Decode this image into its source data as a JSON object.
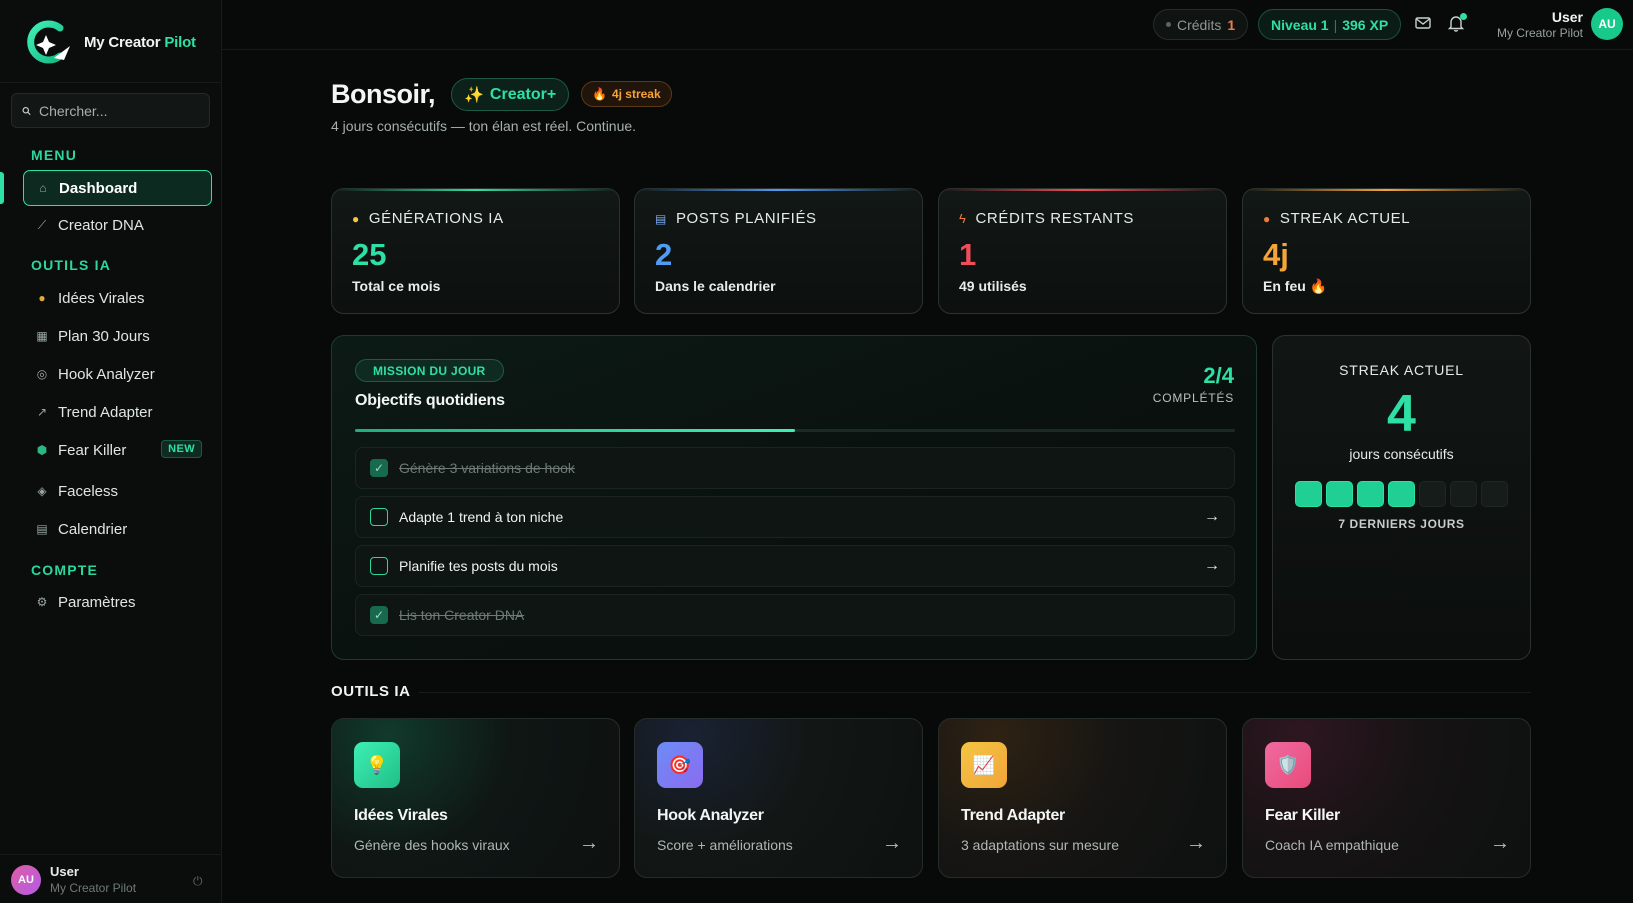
{
  "app": {
    "logo_text_main": "My Creator ",
    "logo_text_accent": "Pilot"
  },
  "search": {
    "placeholder": "Chercher..."
  },
  "sidebar": {
    "menu_label": "MENU",
    "tools_label": "OUTILS IA",
    "account_label": "COMPTE",
    "items": {
      "dashboard": {
        "label": "Dashboard",
        "icon": "house-icon"
      },
      "creator_dna": {
        "label": "Creator DNA",
        "icon": "dna-icon"
      },
      "idees_virales": {
        "label": "Idées Virales",
        "icon": "lightbulb-icon"
      },
      "plan_30": {
        "label": "Plan 30 Jours",
        "icon": "calendar-grid-icon"
      },
      "hook_analyzer": {
        "label": "Hook Analyzer",
        "icon": "target-icon"
      },
      "trend_adapter": {
        "label": "Trend Adapter",
        "icon": "chart-up-icon"
      },
      "fear_killer": {
        "label": "Fear Killer",
        "icon": "shield-icon",
        "badge": "NEW"
      },
      "faceless": {
        "label": "Faceless",
        "icon": "mask-icon"
      },
      "calendrier": {
        "label": "Calendrier",
        "icon": "calendar-icon"
      },
      "parametres": {
        "label": "Paramètres",
        "icon": "gear-icon"
      }
    },
    "user": {
      "initials": "AU",
      "name": "User",
      "sub": "My Creator Pilot"
    }
  },
  "topbar": {
    "credits_label": "Crédits",
    "credits_value": "1",
    "level_label": "Niveau 1",
    "level_sep": "|",
    "xp": "396 XP",
    "user_name": "User",
    "user_sub": "My Creator Pilot",
    "user_initials": "AU"
  },
  "header": {
    "greeting": "Bonsoir,",
    "plan_badge": "Creator+",
    "streak_badge": "4j streak",
    "subtitle": "4 jours consécutifs — ton élan est réel. Continue."
  },
  "stats": [
    {
      "label": "GÉNÉRATIONS IA",
      "value": "25",
      "desc": "Total ce mois",
      "color": "#2ee0a5",
      "icon": "lightbulb-icon"
    },
    {
      "label": "POSTS PLANIFIÉS",
      "value": "2",
      "desc": "Dans le calendrier",
      "color": "#4f9cf5",
      "icon": "calendar-icon"
    },
    {
      "label": "CRÉDITS RESTANTS",
      "value": "1",
      "desc": "49 utilisés",
      "color": "#ef4d5a",
      "icon": "bolt-icon"
    },
    {
      "label": "STREAK ACTUEL",
      "value": "4j",
      "desc": "En feu",
      "color": "#f5a437",
      "icon": "flame-icon"
    }
  ],
  "mission": {
    "tag": "MISSION DU JOUR",
    "title": "Objectifs quotidiens",
    "count": "2/4",
    "done_label": "COMPLÉTÉS",
    "progress": 0.5,
    "tasks": [
      {
        "text": "Génère 3 variations de hook",
        "done": true
      },
      {
        "text": "Adapte 1 trend à ton niche",
        "done": false
      },
      {
        "text": "Planifie tes posts du mois",
        "done": false
      },
      {
        "text": "Lis ton Creator DNA",
        "done": true
      }
    ]
  },
  "streak": {
    "title": "STREAK ACTUEL",
    "value": "4",
    "label": "jours consécutifs",
    "days_on": 4,
    "days_total": 7,
    "footer": "7 DERNIERS JOURS"
  },
  "tools": {
    "heading": "OUTILS IA",
    "items": [
      {
        "name": "Idées Virales",
        "desc": "Génère des hooks viraux",
        "icon": "lightbulb-icon",
        "color": "#2ee0a5"
      },
      {
        "name": "Hook Analyzer",
        "desc": "Score + améliorations",
        "icon": "target-icon",
        "color": "#6c8cf5"
      },
      {
        "name": "Trend Adapter",
        "desc": "3 adaptations sur mesure",
        "icon": "chart-up-icon",
        "color": "#f5b83d"
      },
      {
        "name": "Fear Killer",
        "desc": "Coach IA empathique",
        "icon": "shield-icon",
        "color": "#ef5b8f"
      }
    ]
  }
}
